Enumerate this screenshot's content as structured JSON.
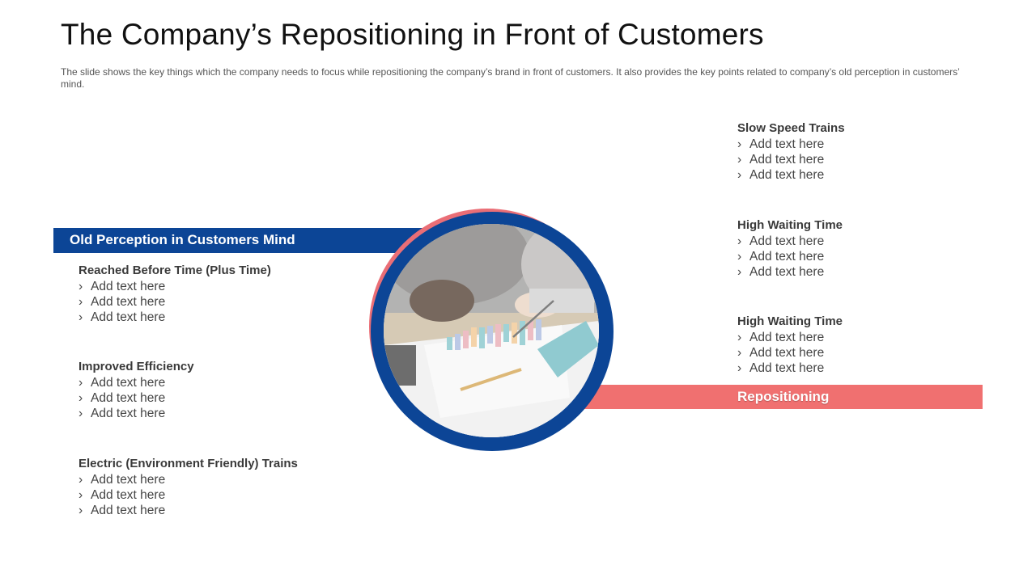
{
  "title": "The Company’s Repositioning in Front of Customers",
  "subtitle": "The slide shows the key things which the company needs to focus while repositioning the company’s brand in front of customers. It also provides the key points related to company’s old perception in customers’ mind.",
  "left_band": {
    "label": "Old Perception in Customers Mind",
    "color": "#0c4596"
  },
  "right_band": {
    "label": "Repositioning",
    "color": "#f07070"
  },
  "bullet_glyph": "›",
  "left_groups": [
    {
      "heading": "Reached Before Time (Plus Time)",
      "items": [
        "Add text here",
        "Add text here",
        "Add text here"
      ]
    },
    {
      "heading": "Improved Efficiency",
      "items": [
        "Add text here",
        "Add text here",
        "Add text here"
      ]
    },
    {
      "heading": "Electric (Environment Friendly) Trains",
      "items": [
        "Add text here",
        "Add text here",
        "Add text here"
      ]
    }
  ],
  "right_groups": [
    {
      "heading": "Slow Speed Trains",
      "items": [
        "Add text here",
        "Add text here",
        "Add text here"
      ]
    },
    {
      "heading": "High Waiting Time",
      "items": [
        "Add text here",
        "Add text here",
        "Add text here"
      ]
    },
    {
      "heading": "High Waiting Time",
      "items": [
        "Add text here",
        "Add text here",
        "Add text here"
      ]
    }
  ],
  "ring_colors": {
    "outer": "#ea6e76",
    "inner": "#0c4596"
  }
}
